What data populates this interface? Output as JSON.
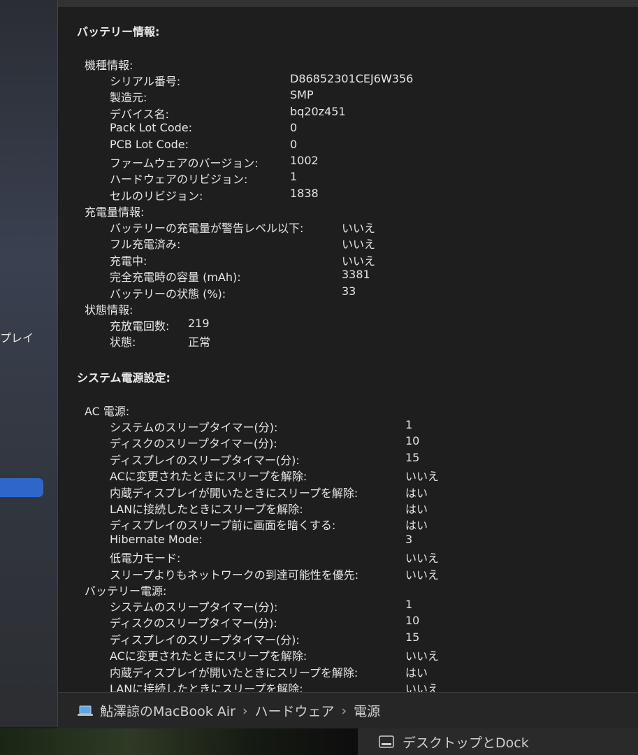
{
  "sidebar": {
    "partial_label": "プレイ"
  },
  "battery": {
    "title": "バッテリー情報:",
    "model": {
      "title": "機種情報:",
      "rows": [
        {
          "k": "シリアル番号:",
          "v": "D86852301CEJ6W356"
        },
        {
          "k": "製造元:",
          "v": "SMP"
        },
        {
          "k": "デバイス名:",
          "v": "bq20z451"
        },
        {
          "k": "Pack Lot Code:",
          "v": "0"
        },
        {
          "k": "PCB Lot Code:",
          "v": "0"
        },
        {
          "k": "ファームウェアのバージョン:",
          "v": "1002"
        },
        {
          "k": "ハードウェアのリビジョン:",
          "v": "1"
        },
        {
          "k": "セルのリビジョン:",
          "v": "1838"
        }
      ]
    },
    "charge": {
      "title": "充電量情報:",
      "rows": [
        {
          "k": "バッテリーの充電量が警告レベル以下:",
          "v": "いいえ"
        },
        {
          "k": "フル充電済み:",
          "v": "いいえ"
        },
        {
          "k": "充電中:",
          "v": "いいえ"
        },
        {
          "k": "完全充電時の容量 (mAh):",
          "v": "3381"
        },
        {
          "k": "バッテリーの状態 (%):",
          "v": "33"
        }
      ]
    },
    "health": {
      "title": "状態情報:",
      "rows": [
        {
          "k": "充放電回数:",
          "v": "219"
        },
        {
          "k": "状態:",
          "v": "正常"
        }
      ]
    }
  },
  "power": {
    "title": "システム電源設定:",
    "ac": {
      "title": "AC 電源:",
      "rows": [
        {
          "k": "システムのスリープタイマー(分):",
          "v": "1"
        },
        {
          "k": "ディスクのスリープタイマー(分):",
          "v": "10"
        },
        {
          "k": "ディスプレイのスリープタイマー(分):",
          "v": "15"
        },
        {
          "k": "ACに変更されたときにスリープを解除:",
          "v": "いいえ"
        },
        {
          "k": "内蔵ディスプレイが開いたときにスリープを解除:",
          "v": "はい"
        },
        {
          "k": "LANに接続したときにスリープを解除:",
          "v": "はい"
        },
        {
          "k": "ディスプレイのスリープ前に画面を暗くする:",
          "v": "はい"
        },
        {
          "k": "Hibernate Mode:",
          "v": "3"
        },
        {
          "k": "低電力モード:",
          "v": "いいえ"
        },
        {
          "k": "スリープよりもネットワークの到達可能性を優先:",
          "v": "いいえ"
        }
      ]
    },
    "battery": {
      "title": "バッテリー電源:",
      "rows": [
        {
          "k": "システムのスリープタイマー(分):",
          "v": "1"
        },
        {
          "k": "ディスクのスリープタイマー(分):",
          "v": "10"
        },
        {
          "k": "ディスプレイのスリープタイマー(分):",
          "v": "15"
        },
        {
          "k": "ACに変更されたときにスリープを解除:",
          "v": "いいえ"
        },
        {
          "k": "内蔵ディスプレイが開いたときにスリープを解除:",
          "v": "はい"
        },
        {
          "k": "LANに接続したときにスリープを解除:",
          "v": "いいえ"
        }
      ]
    }
  },
  "pathbar": {
    "icon": "laptop-icon",
    "items": [
      "鮎澤諒のMacBook Air",
      "ハードウェア",
      "電源"
    ],
    "separator": "›"
  },
  "dock": {
    "label": "デスクトップとDock",
    "icon": "window-icon"
  }
}
